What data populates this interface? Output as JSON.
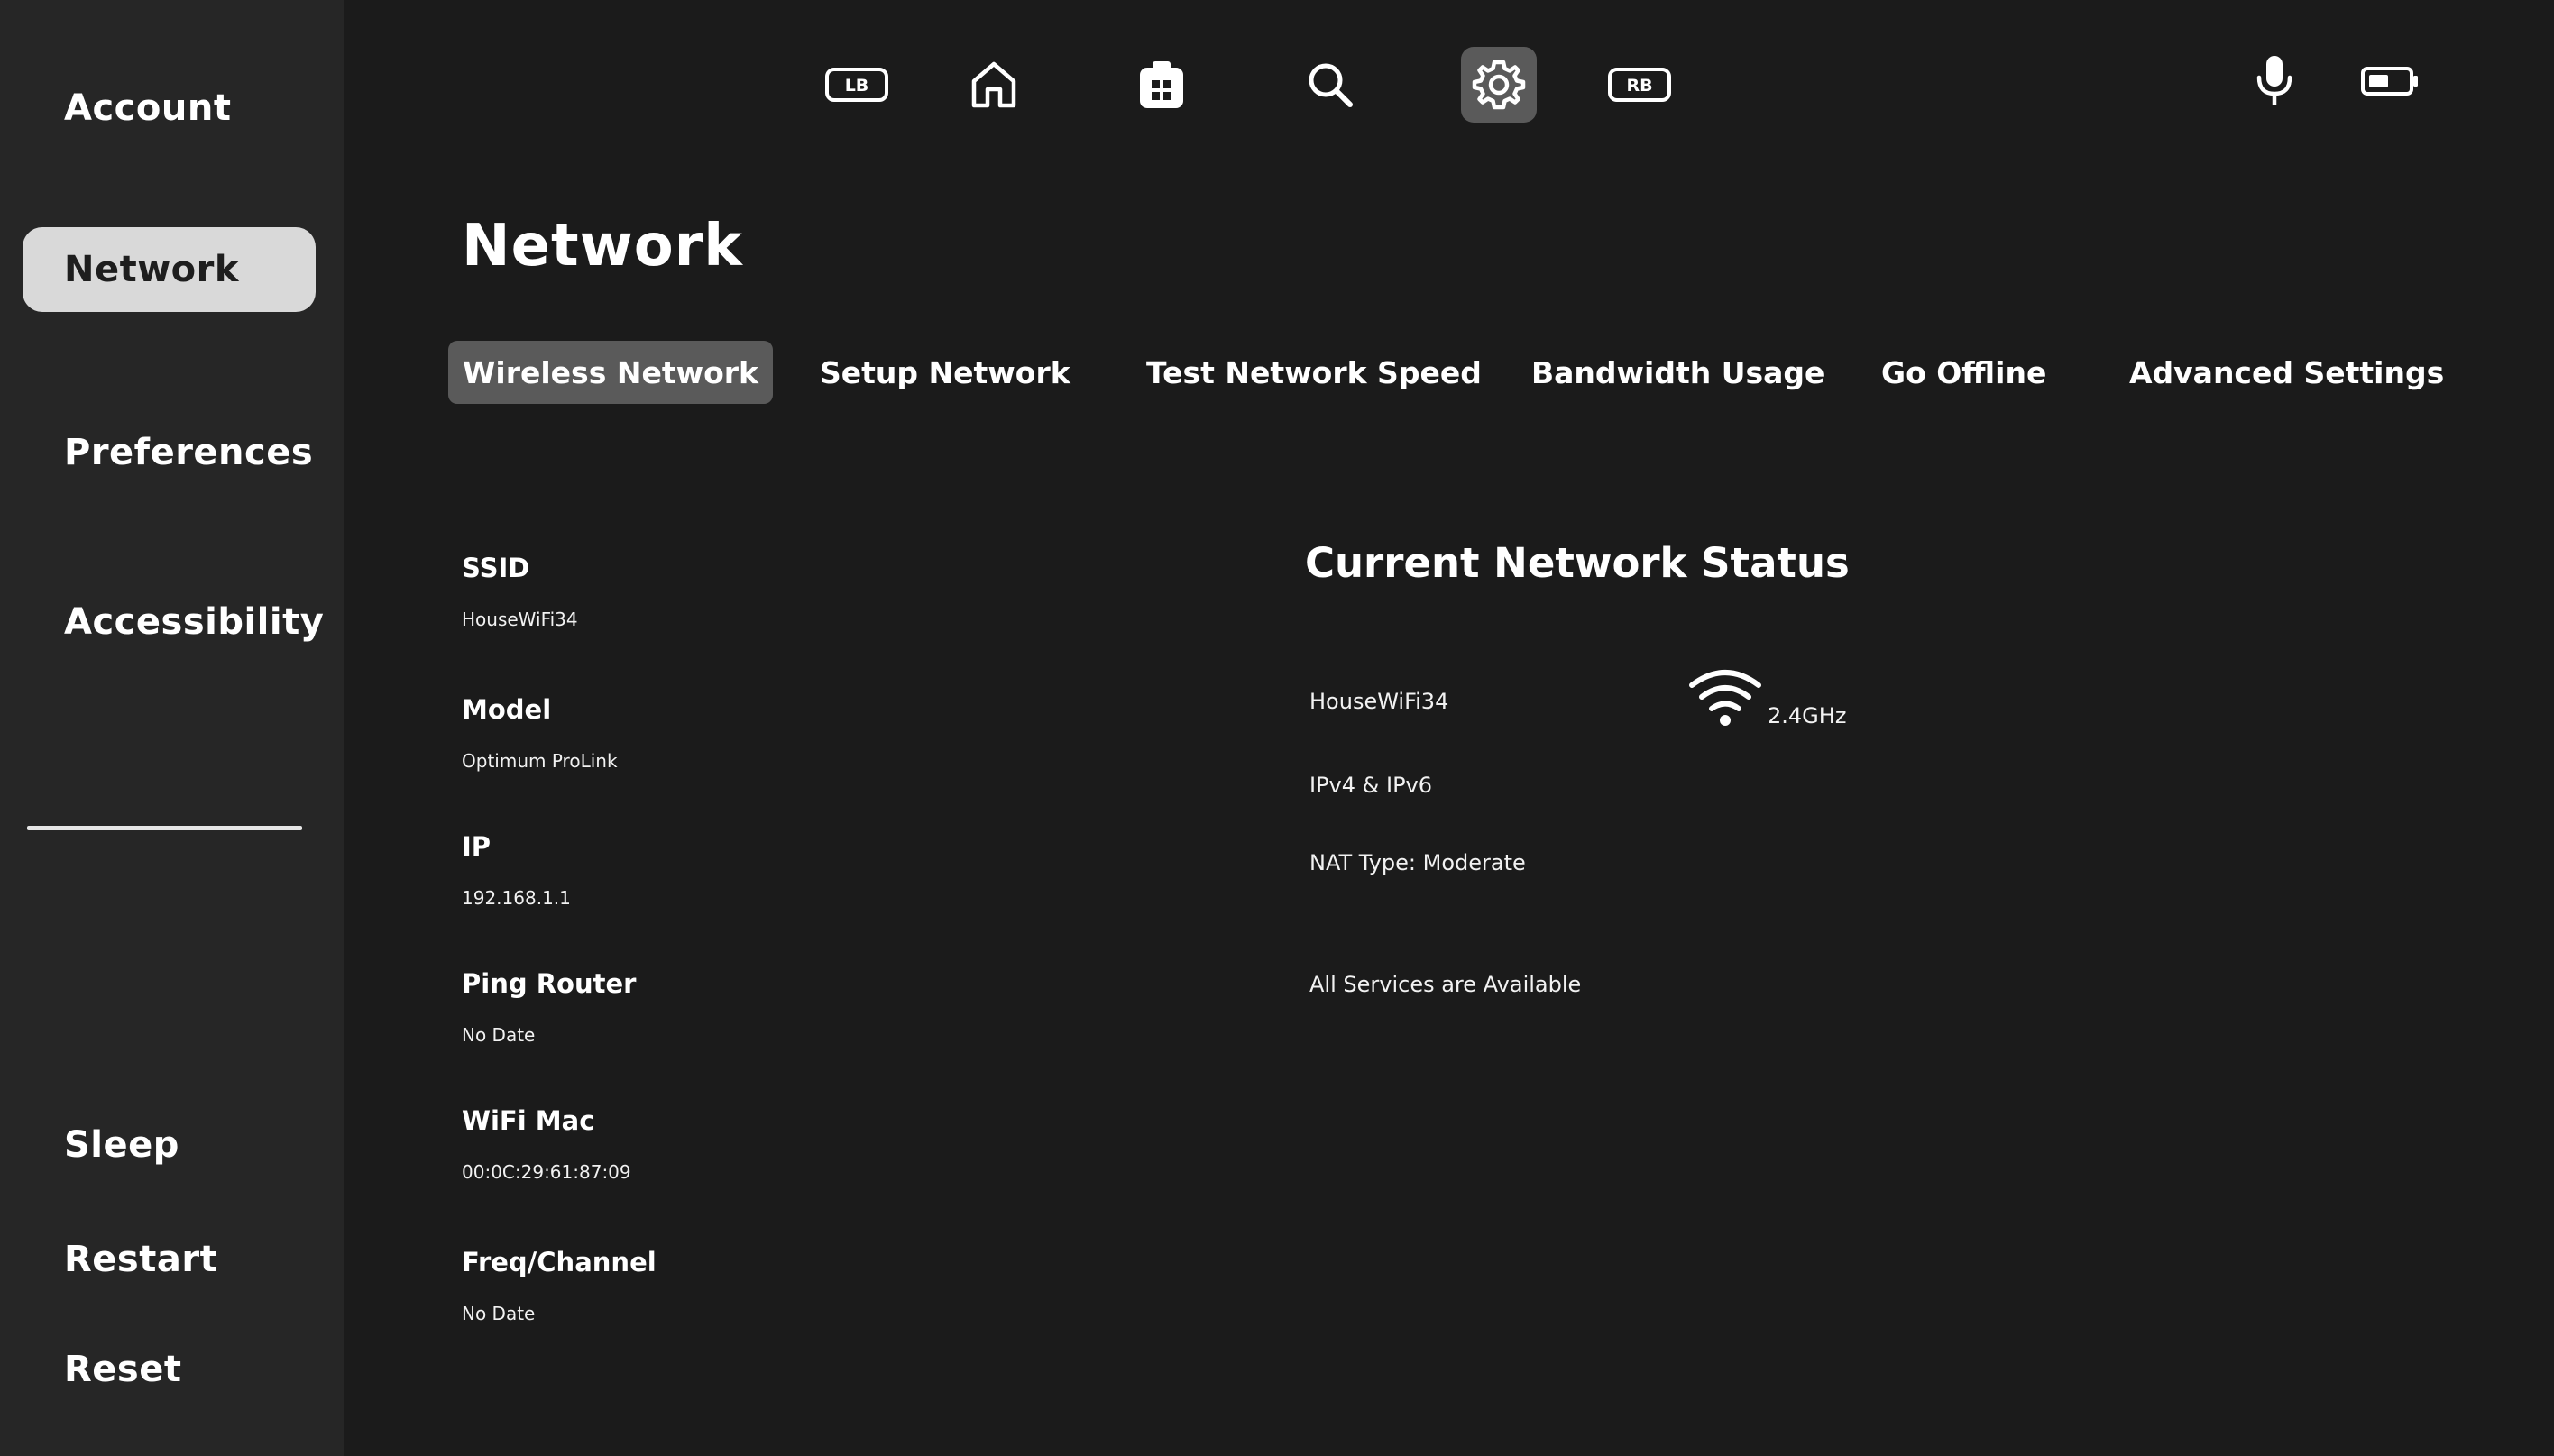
{
  "sidebar": {
    "items": [
      {
        "label": "Account"
      },
      {
        "label": "Network",
        "selected": true
      },
      {
        "label": "Preferences"
      },
      {
        "label": "Accessibility"
      },
      {
        "label": "Sleep"
      },
      {
        "label": "Restart"
      },
      {
        "label": "Reset"
      }
    ]
  },
  "topbar": {
    "lb": "LB",
    "rb": "RB",
    "icons": [
      "lb-bumper-icon",
      "home-icon",
      "apps-icon",
      "search-icon",
      "settings-icon",
      "rb-bumper-icon",
      "microphone-icon",
      "battery-icon"
    ],
    "active": "settings-icon"
  },
  "page": {
    "title": "Network"
  },
  "tabs": [
    {
      "label": "Wireless Network",
      "selected": true
    },
    {
      "label": "Setup Network"
    },
    {
      "label": "Test Network Speed"
    },
    {
      "label": "Bandwidth Usage"
    },
    {
      "label": "Go Offline"
    },
    {
      "label": "Advanced Settings"
    }
  ],
  "details": [
    {
      "label": "SSID",
      "value": "HouseWiFi34"
    },
    {
      "label": "Model",
      "value": "Optimum ProLink"
    },
    {
      "label": "IP",
      "value": "192.168.1.1"
    },
    {
      "label": "Ping Router",
      "value": "No Date"
    },
    {
      "label": "WiFi Mac",
      "value": "00:0C:29:61:87:09"
    },
    {
      "label": "Freq/Channel",
      "value": "No Date"
    }
  ],
  "status": {
    "title": "Current Network Status",
    "ssid": "HouseWiFi34",
    "band": "2.4GHz",
    "protocol": "IPv4 & IPv6",
    "nat": "NAT Type: Moderate",
    "services": "All Services are Available"
  },
  "colors": {
    "background": "#1b1b1b",
    "sidebar": "#262626",
    "selected_side": "#d9d9d9",
    "selected_tab": "#5a5a5a"
  }
}
